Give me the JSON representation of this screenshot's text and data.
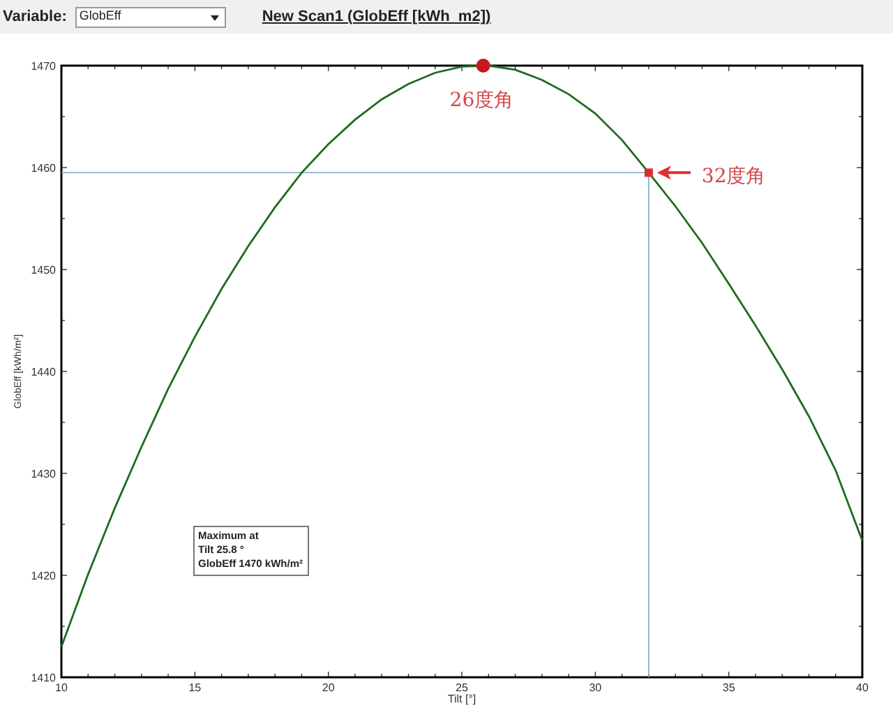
{
  "toolbar": {
    "variable_label": "Variable:",
    "variable_select": {
      "value": "GlobEff"
    },
    "scan_title": "New Scan1 (GlobEff [kWh  m2])"
  },
  "chart": {
    "chart_data": {
      "type": "line",
      "xlabel": "Tilt [°]",
      "ylabel": "GlobEff [kWh/m²]",
      "x": [
        10,
        11,
        12,
        13,
        14,
        15,
        16,
        17,
        18,
        19,
        20,
        21,
        22,
        23,
        24,
        25,
        26,
        27,
        28,
        29,
        30,
        31,
        32,
        33,
        34,
        35,
        36,
        37,
        38,
        39,
        40
      ],
      "series": [
        {
          "color": "#1e6b1e",
          "values": [
            1413,
            1420.1,
            1426.6,
            1432.6,
            1438.3,
            1443.4,
            1448.1,
            1452.3,
            1456.1,
            1459.5,
            1462.3,
            1464.7,
            1466.7,
            1468.2,
            1469.3,
            1469.9,
            1470,
            1469.6,
            1468.6,
            1467.2,
            1465.3,
            1462.7,
            1459.5,
            1456.2,
            1452.6,
            1448.6,
            1444.5,
            1440.2,
            1435.6,
            1430.3,
            1423.4
          ]
        }
      ],
      "xlim": [
        10,
        40
      ],
      "ylim": [
        1410,
        1470
      ],
      "xticks": [
        10,
        15,
        20,
        25,
        30,
        35,
        40
      ],
      "yticks": [
        1410,
        1420,
        1430,
        1440,
        1450,
        1460,
        1470
      ],
      "ref_lines": [
        {
          "axis": "y",
          "value": 1459.5
        },
        {
          "axis": "x",
          "value": 32
        }
      ],
      "annotations": [
        {
          "text": "26度角",
          "x": 25.8,
          "y": 1470
        },
        {
          "text": "32度角",
          "x": 32,
          "y": 1459.5
        }
      ]
    },
    "info_box": {
      "lines": [
        "Maximum at",
        "Tilt 25.8 °",
        "GlobEff 1470 kWh/m²"
      ]
    }
  }
}
